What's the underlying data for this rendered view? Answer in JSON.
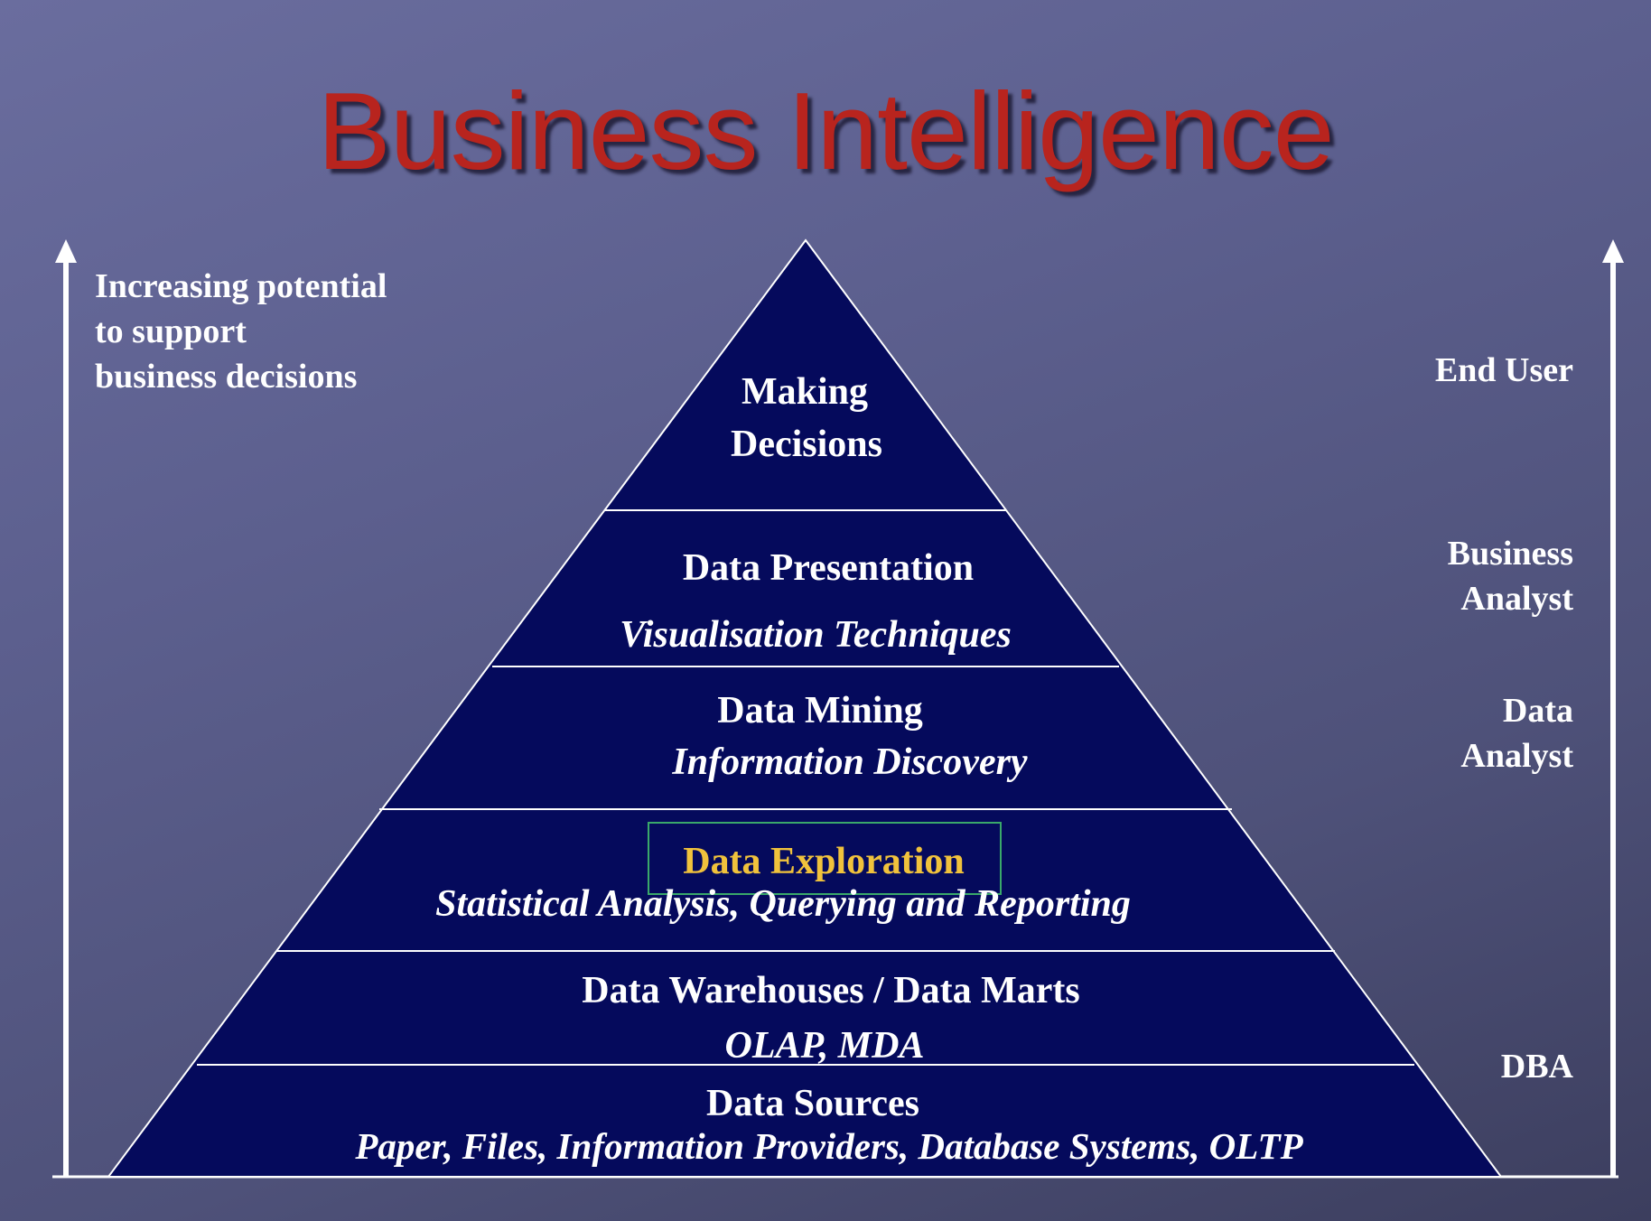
{
  "title": "Business Intelligence",
  "left_caption": "Increasing potential\nto support\nbusiness decisions",
  "roles": {
    "end_user": "End User",
    "business_analyst": "Business\nAnalyst",
    "data_analyst": "Data\nAnalyst",
    "dba": "DBA"
  },
  "pyramid": {
    "fill_color": "#050a5c",
    "layers": [
      {
        "title": "Making",
        "title2": "Decisions",
        "subtitle": ""
      },
      {
        "title": "Data Presentation",
        "subtitle": "Visualisation Techniques"
      },
      {
        "title": "Data Mining",
        "subtitle": "Information Discovery"
      },
      {
        "title": "Data Exploration",
        "subtitle": "Statistical Analysis, Querying and Reporting",
        "highlight_color": "#f0c23c"
      },
      {
        "title": "Data Warehouses / Data Marts",
        "subtitle": "OLAP, MDA"
      },
      {
        "title": "Data Sources",
        "subtitle": "Paper, Files, Information Providers, Database Systems, OLTP"
      }
    ]
  }
}
